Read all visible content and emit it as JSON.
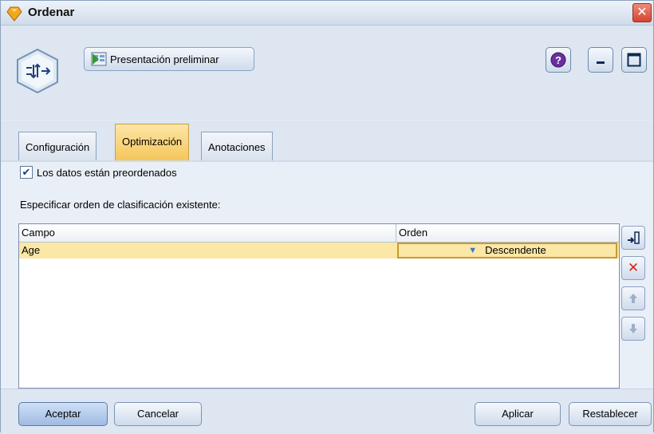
{
  "window": {
    "title": "Ordenar",
    "close_glyph": "✕"
  },
  "toolbar": {
    "preview_label": "Presentación preliminar",
    "help_glyph": "?"
  },
  "tabs": [
    {
      "label": "Configuración",
      "active": false
    },
    {
      "label": "Optimización",
      "active": true
    },
    {
      "label": "Anotaciones",
      "active": false
    }
  ],
  "optimization": {
    "presorted_label": "Los datos están preordenados",
    "presorted_checked": true,
    "spec_label": "Especificar orden de clasificación existente:"
  },
  "table": {
    "columns": [
      "Campo",
      "Orden"
    ],
    "rows": [
      {
        "field": "Age",
        "order": "Descendente"
      }
    ]
  },
  "side_buttons": {
    "add_glyph": "▾",
    "delete_glyph": "✕",
    "up_glyph": "🡡",
    "down_glyph": "🡣"
  },
  "footer": {
    "ok": "Aceptar",
    "cancel": "Cancelar",
    "apply": "Aplicar",
    "reset": "Restablecer"
  },
  "colors": {
    "active_tab": "#f6c65a",
    "selected_row": "#fbe7a6",
    "delete_red": "#d9231b"
  }
}
